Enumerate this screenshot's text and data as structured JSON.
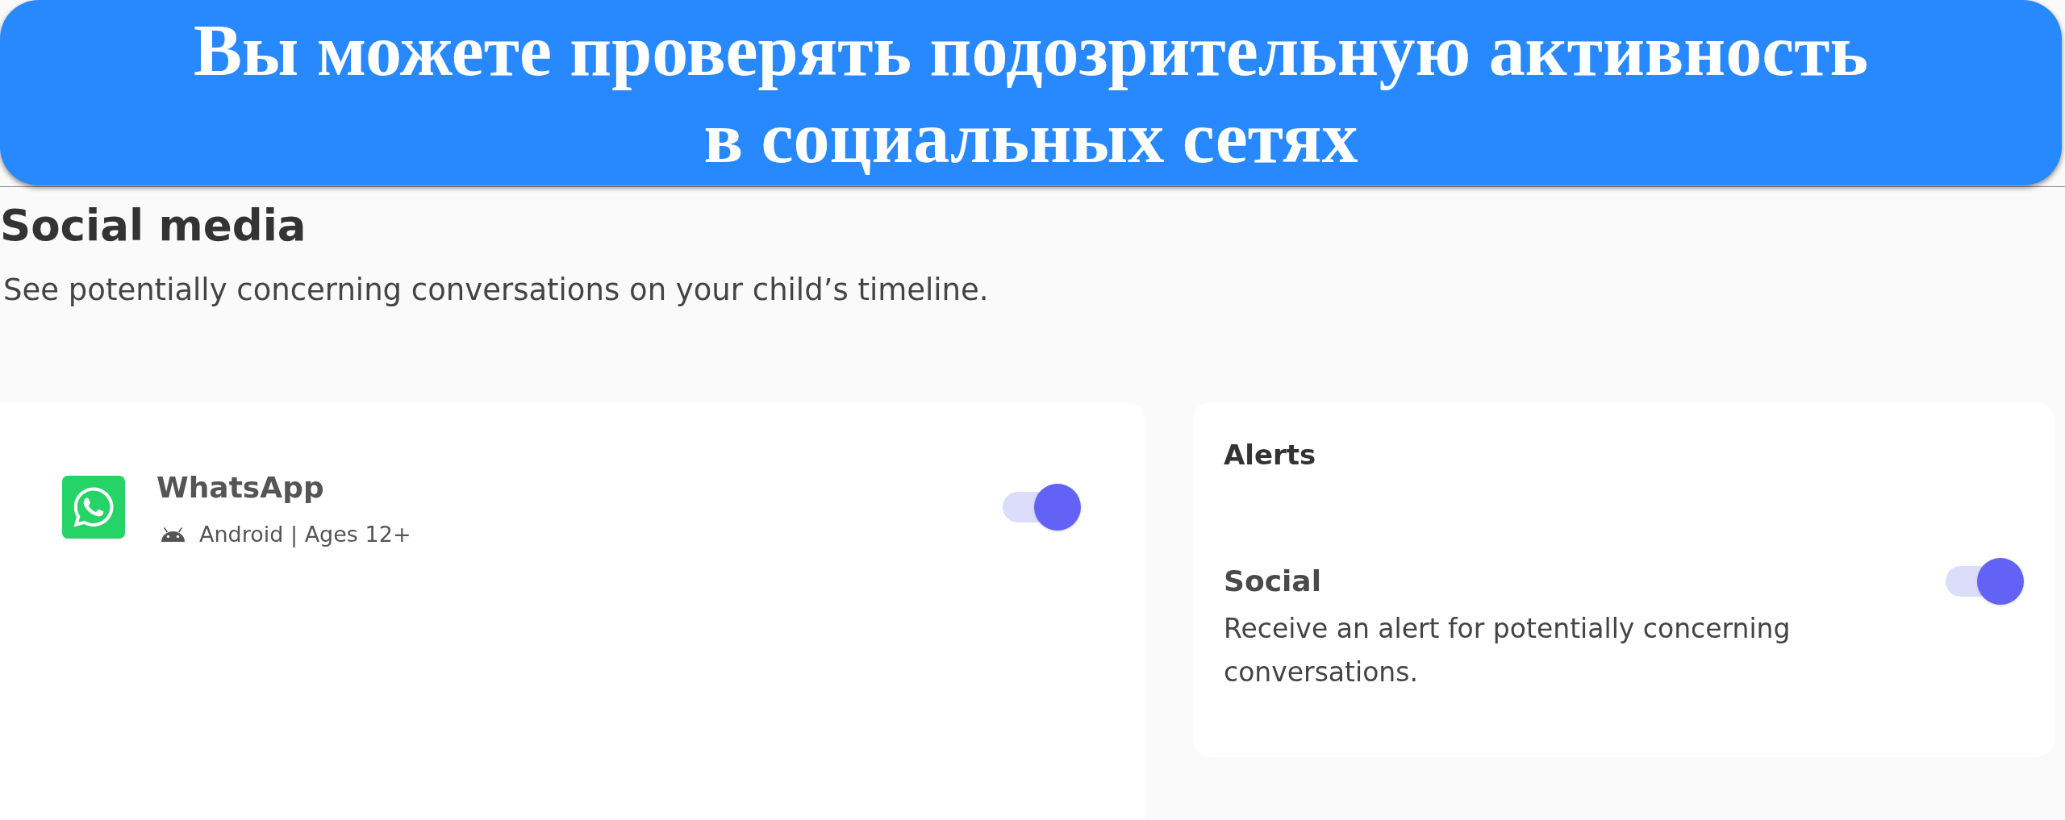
{
  "banner": {
    "lines": [
      "Вы можете проверять подозрительную активность",
      "в социальных сетях"
    ]
  },
  "header": {
    "title": "Social media",
    "subtitle": "See potentially concerning conversations on your child’s timeline."
  },
  "apps": [
    {
      "name": "WhatsApp",
      "details": "Android | Ages 12+",
      "on": true
    }
  ],
  "alerts": {
    "title": "Alerts",
    "items": [
      {
        "name": "Social",
        "description": "Receive an alert for potentially concerning conversations.",
        "on": true
      }
    ]
  }
}
